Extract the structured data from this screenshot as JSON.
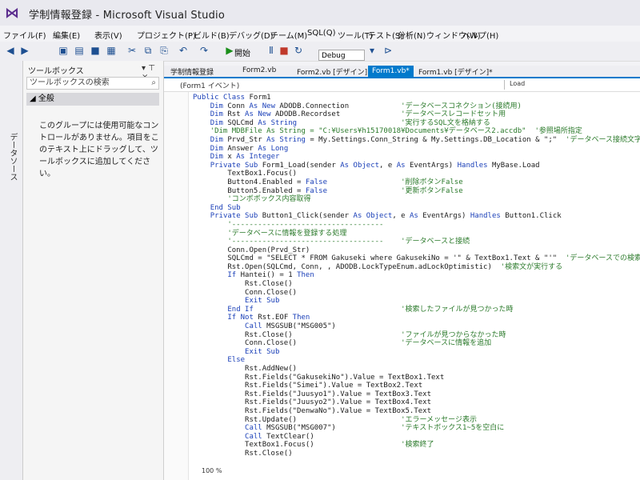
{
  "window": {
    "title": "学制情報登録 - Microsoft Visual Studio"
  },
  "menu": [
    "ファイル(F)",
    "編集(E)",
    "表示(V)",
    "プロジェクト(P)",
    "ビルド(B)",
    "デバッグ(D)",
    "チーム(M)",
    "SQL(Q)",
    "ツール(T)",
    "テスト(S)",
    "分析(N)",
    "ウィンドウ(W)",
    "ヘルプ(H)"
  ],
  "toolbar": {
    "start_label": "開始",
    "config": "Debug"
  },
  "side_tab": "データソース",
  "toolbox": {
    "title": "ツールボックス",
    "pin": "▾ ⊤ ×",
    "search_placeholder": "ツールボックスの検索",
    "group": "◢ 全般",
    "empty_text": "このグループには使用可能なコントロールがありません。項目をこのテキスト上にドラッグして、ツールボックスに追加してください。"
  },
  "tabs": [
    "学制情報登録",
    "Form2.vb",
    "Form2.vb [デザイン]",
    "Form1.vb*",
    "Form1.vb [デザイン]*"
  ],
  "navbar": {
    "left": "(Form1 イベント)",
    "right": "Load"
  },
  "code": [
    {
      "t": "Public Class Form1",
      "c": ""
    },
    {
      "t": "    Dim Conn As New ADODB.Connection",
      "c": "'データベースコネクション(接続用)"
    },
    {
      "t": "    Dim Rst As New ADODB.Recordset",
      "c": "'データベースレコードセット用"
    },
    {
      "t": "    Dim SQLCmd As String",
      "c": "'実行するSQL文を格納する"
    },
    {
      "t": "    'Dim MDBFile As String = \"C:¥Users¥h15170018¥Documents¥データベース2.accdb\"",
      "c": "'参照場所指定"
    },
    {
      "t": "    Dim Prvd_Str As String = My.Settings.Conn_String & My.Settings.DB_Location & \";\"",
      "c": "'データベース接続文字列"
    },
    {
      "t": "    Dim Answer As Long",
      "c": ""
    },
    {
      "t": "    Dim x As Integer",
      "c": ""
    },
    {
      "t": "",
      "c": ""
    },
    {
      "t": "    Private Sub Form1_Load(sender As Object, e As EventArgs) Handles MyBase.Load",
      "c": ""
    },
    {
      "t": "        TextBox1.Focus()",
      "c": ""
    },
    {
      "t": "        Button4.Enabled = False",
      "c": "'削除ボタンFalse"
    },
    {
      "t": "        Button5.Enabled = False",
      "c": "'更新ボタンFalse"
    },
    {
      "t": "",
      "c": ""
    },
    {
      "t": "        'コンボボックス内容取得",
      "c": ""
    },
    {
      "t": "",
      "c": ""
    },
    {
      "t": "    End Sub",
      "c": ""
    },
    {
      "t": "    Private Sub Button1_Click(sender As Object, e As EventArgs) Handles Button1.Click",
      "c": ""
    },
    {
      "t": "        '-----------------------------------",
      "c": ""
    },
    {
      "t": "        'データベースに情報を登録する処理",
      "c": ""
    },
    {
      "t": "        '-----------------------------------",
      "c": "'データベースと接続"
    },
    {
      "t": "        Conn.Open(Prvd_Str)",
      "c": ""
    },
    {
      "t": "        SQLCmd = \"SELECT * FROM Gakuseki where GakusekiNo = '\" & TextBox1.Text & \"'\"",
      "c": "'データベースでの検索文"
    },
    {
      "t": "        Rst.Open(SQLCmd, Conn, , ADODB.LockTypeEnum.adLockOptimistic)",
      "c": "'検索文が実行する"
    },
    {
      "t": "",
      "c": ""
    },
    {
      "t": "        If Hantei() = 1 Then",
      "c": ""
    },
    {
      "t": "            Rst.Close()",
      "c": ""
    },
    {
      "t": "            Conn.Close()",
      "c": ""
    },
    {
      "t": "            Exit Sub",
      "c": ""
    },
    {
      "t": "        End If",
      "c": "'検索したファイルが見つかった時"
    },
    {
      "t": "",
      "c": ""
    },
    {
      "t": "        If Not Rst.EOF Then",
      "c": ""
    },
    {
      "t": "            Call MSGSUB(\"MSG005\")",
      "c": ""
    },
    {
      "t": "            Rst.Close()",
      "c": "'ファイルが見つからなかった時"
    },
    {
      "t": "            Conn.Close()",
      "c": "'データベースに情報を追加"
    },
    {
      "t": "            Exit Sub",
      "c": ""
    },
    {
      "t": "        Else",
      "c": ""
    },
    {
      "t": "            Rst.AddNew()",
      "c": ""
    },
    {
      "t": "            Rst.Fields(\"GakusekiNo\").Value = TextBox1.Text",
      "c": ""
    },
    {
      "t": "            Rst.Fields(\"Simei\").Value = TextBox2.Text",
      "c": ""
    },
    {
      "t": "            Rst.Fields(\"Juusyo1\").Value = TextBox3.Text",
      "c": ""
    },
    {
      "t": "            Rst.Fields(\"Juusyo2\").Value = TextBox4.Text",
      "c": ""
    },
    {
      "t": "            Rst.Fields(\"DenwaNo\").Value = TextBox5.Text",
      "c": ""
    },
    {
      "t": "            Rst.Update()",
      "c": "'エラーメッセージ表示"
    },
    {
      "t": "            Call MSGSUB(\"MSG007\")",
      "c": "'テキストボックス1~5を空白に"
    },
    {
      "t": "            Call TextClear()",
      "c": ""
    },
    {
      "t": "            TextBox1.Focus()",
      "c": "'検索終了"
    },
    {
      "t": "            Rst.Close()",
      "c": ""
    }
  ],
  "status": {
    "zoom": "100 %"
  }
}
